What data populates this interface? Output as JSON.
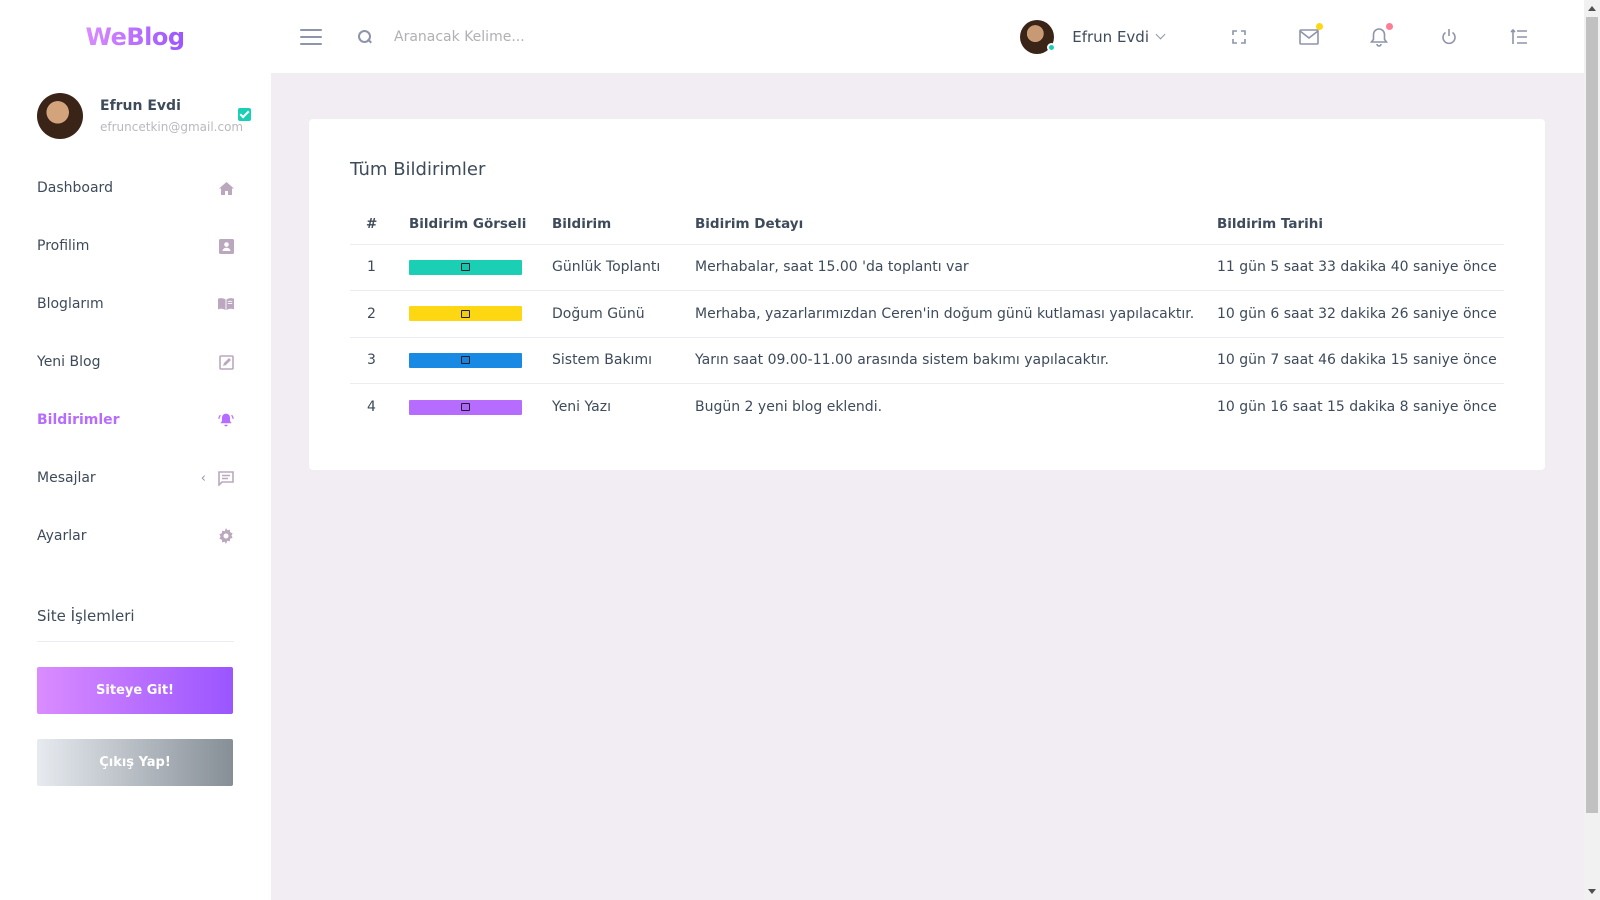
{
  "brand": "WeBlog",
  "search": {
    "placeholder": "Aranacak Kelime..."
  },
  "topbar": {
    "user_name": "Efrun Evdi"
  },
  "profile": {
    "name": "Efrun Evdi",
    "email": "efruncetkin@gmail.com"
  },
  "sidebar": {
    "items": [
      {
        "label": "Dashboard",
        "icon": "home-icon"
      },
      {
        "label": "Profilim",
        "icon": "contact-card-icon"
      },
      {
        "label": "Bloglarım",
        "icon": "book-icon"
      },
      {
        "label": "Yeni Blog",
        "icon": "edit-icon"
      },
      {
        "label": "Bildirimler",
        "icon": "bell-icon",
        "active": true
      },
      {
        "label": "Mesajlar",
        "icon": "message-icon"
      },
      {
        "label": "Ayarlar",
        "icon": "gear-icon"
      }
    ],
    "site_section_title": "Site İşlemleri",
    "go_site_label": "Siteye Git!",
    "logout_label": "Çıkış Yap!"
  },
  "main": {
    "title": "Tüm Bildirimler",
    "columns": [
      "#",
      "Bildirim Görseli",
      "Bildirim",
      "Bidirim Detayı",
      "Bildirim Tarihi"
    ],
    "rows": [
      {
        "num": "1",
        "color": "#1bcfb4",
        "icon": "calendar-icon",
        "name": "Günlük Toplantı",
        "detail": "Merhabalar, saat 15.00 'da toplantı var",
        "date": "11 gün 5 saat 33 dakika 40 saniye önce"
      },
      {
        "num": "2",
        "color": "#fed713",
        "icon": "cake-icon",
        "name": "Doğum Günü",
        "detail": "Merhaba, yazarlarımızdan Ceren'in doğum günü kutlaması yapılacaktır.",
        "date": "10 gün 6 saat 32 dakika 26 saniye önce"
      },
      {
        "num": "3",
        "color": "#198ae3",
        "icon": "settings-icon",
        "name": "Sistem Bakımı",
        "detail": "Yarın saat 09.00-11.00 arasında sistem bakımı yapılacaktır.",
        "date": "10 gün 7 saat 46 dakika 15 saniye önce"
      },
      {
        "num": "4",
        "color": "#b66dff",
        "icon": "new-post-icon",
        "name": "Yeni Yazı",
        "detail": "Bugün 2 yeni blog eklendi.",
        "date": "10 gün 16 saat 15 dakika 8 saniye önce"
      }
    ]
  },
  "colors": {
    "accent": "#b66dff",
    "teal": "#1bcfb4",
    "yellow": "#fed713",
    "blue": "#198ae3",
    "red": "#fe7c96"
  }
}
